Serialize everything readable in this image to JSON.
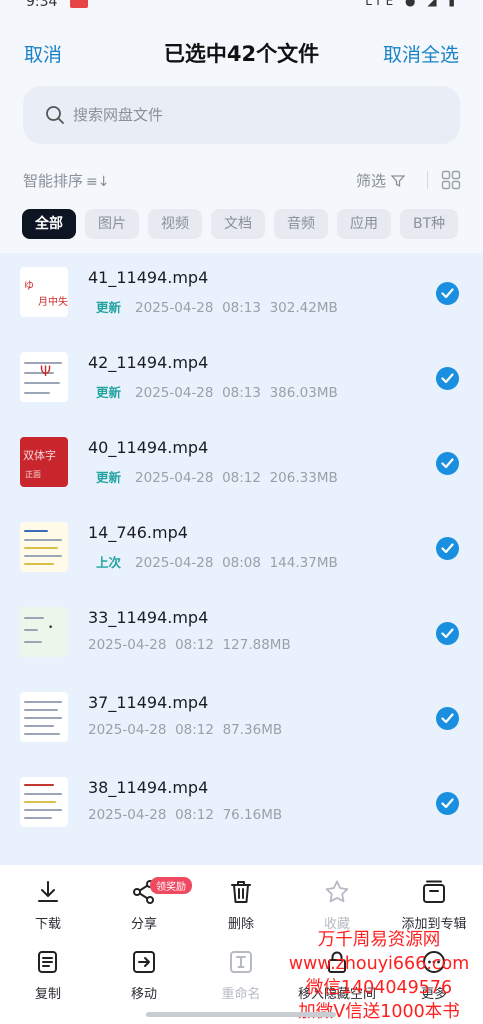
{
  "status": {
    "time": "9:34",
    "right_icons": "LTE ● ◢ ▮"
  },
  "header": {
    "cancel_label": "取消",
    "title": "已选中42个文件",
    "deselect_label": "取消全选"
  },
  "search": {
    "placeholder": "搜索网盘文件",
    "value": ""
  },
  "toolbar": {
    "sort_label": "智能排序",
    "sort_icon": "≡↓",
    "filter_label": "筛选",
    "filter_icon": "funnel-icon",
    "view_icon": "grid-icon"
  },
  "tabs": [
    {
      "label": "全部",
      "active": true
    },
    {
      "label": "图片"
    },
    {
      "label": "视频"
    },
    {
      "label": "文档"
    },
    {
      "label": "音频"
    },
    {
      "label": "应用"
    },
    {
      "label": "BT种"
    }
  ],
  "files": [
    {
      "name": "41_11494.mp4",
      "badge": "更新",
      "date": "2025-04-28",
      "time": "08:13",
      "size": "302.42MB",
      "selected": true
    },
    {
      "name": "42_11494.mp4",
      "badge": "更新",
      "date": "2025-04-28",
      "time": "08:13",
      "size": "386.03MB",
      "selected": true
    },
    {
      "name": "40_11494.mp4",
      "badge": "更新",
      "date": "2025-04-28",
      "time": "08:12",
      "size": "206.33MB",
      "selected": true
    },
    {
      "name": "14_746.mp4",
      "badge": "上次",
      "date": "2025-04-28",
      "time": "08:08",
      "size": "144.37MB",
      "selected": true
    },
    {
      "name": "33_11494.mp4",
      "badge": "",
      "date": "2025-04-28",
      "time": "08:12",
      "size": "127.88MB",
      "selected": true
    },
    {
      "name": "37_11494.mp4",
      "badge": "",
      "date": "2025-04-28",
      "time": "08:12",
      "size": "87.36MB",
      "selected": true
    },
    {
      "name": "38_11494.mp4",
      "badge": "",
      "date": "2025-04-28",
      "time": "08:12",
      "size": "76.16MB",
      "selected": true
    }
  ],
  "actions": {
    "download": "下载",
    "share": "分享",
    "share_badge": "领奖励",
    "delete": "删除",
    "favorite": "收藏",
    "add_to_album": "添加到专辑",
    "copy": "复制",
    "move": "移动",
    "rename": "重命名",
    "lock": "移入隐藏空间",
    "more": "更多"
  },
  "watermark": {
    "line1": "万千周易资源网",
    "line2": "www.zhouyi666.com",
    "line3": "微信1404049576",
    "line4": "加微V信送1000本书"
  },
  "colors": {
    "accent": "#1a82c6",
    "check": "#1a8fe0",
    "badge": "#23a3a0",
    "watermark": "#ff1f1f"
  }
}
